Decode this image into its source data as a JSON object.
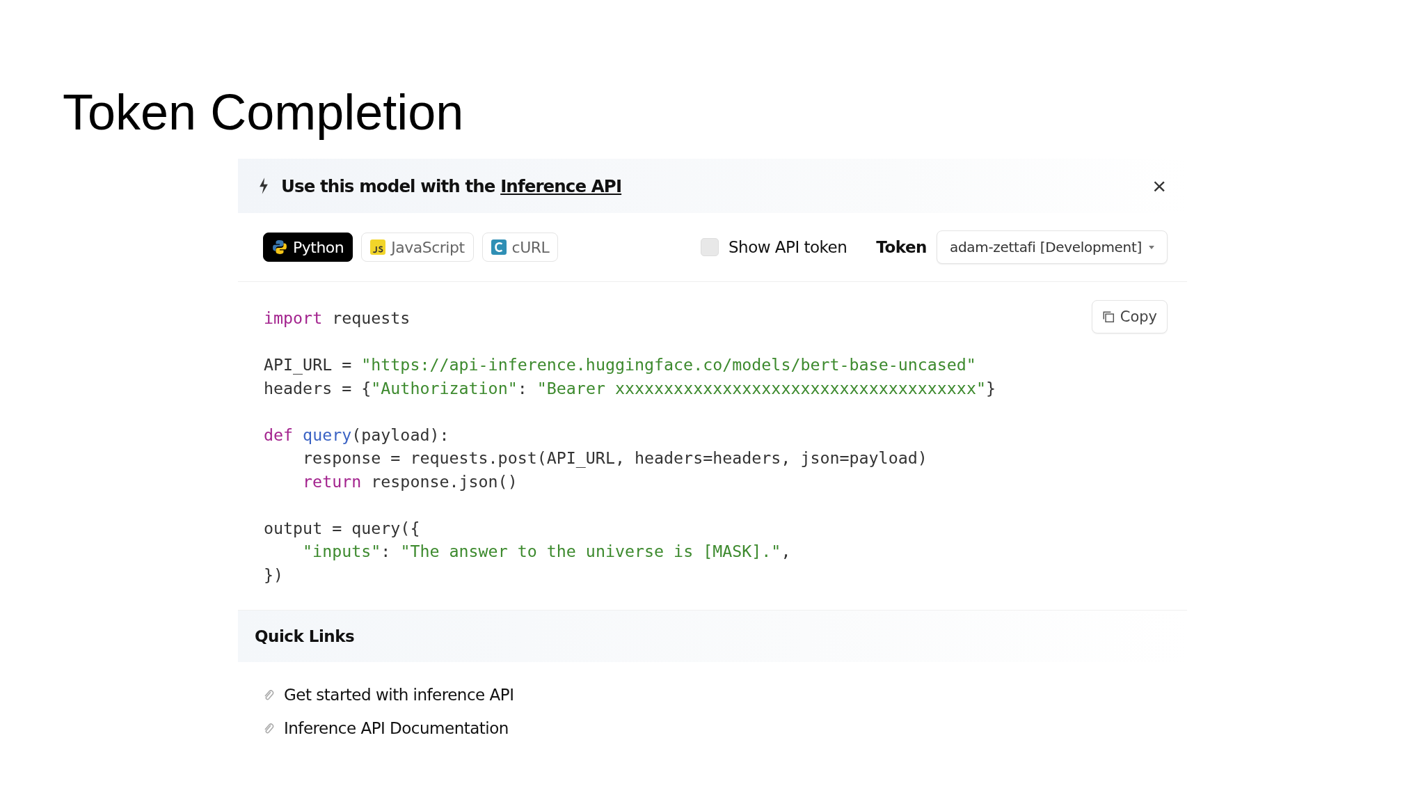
{
  "slide_title": "Token Completion",
  "panel": {
    "header": {
      "prefix": "Use this model with the ",
      "link": "Inference API",
      "close": "×"
    },
    "language_tabs": [
      {
        "label": "Python",
        "kind": "python",
        "selected": true
      },
      {
        "label": "JavaScript",
        "kind": "js",
        "selected": false
      },
      {
        "label": "cURL",
        "kind": "curl",
        "selected": false
      }
    ],
    "show_token": {
      "label": "Show API token",
      "checked": false
    },
    "token": {
      "label": "Token",
      "value": "adam-zettafi [Development]"
    },
    "copy_button": "Copy",
    "code_blocks": [
      [
        {
          "tokens": [
            {
              "kind": "keyword",
              "text": "import"
            },
            {
              "kind": "plain",
              "text": " requests"
            }
          ]
        }
      ],
      [
        {
          "tokens": [
            {
              "kind": "plain",
              "text": "API_URL = "
            },
            {
              "kind": "string",
              "text": "\"https://api-inference.huggingface.co/models/bert-base-uncased\""
            }
          ]
        },
        {
          "tokens": [
            {
              "kind": "plain",
              "text": "headers = {"
            },
            {
              "kind": "string",
              "text": "\"Authorization\""
            },
            {
              "kind": "plain",
              "text": ": "
            },
            {
              "kind": "string",
              "text": "\"Bearer xxxxxxxxxxxxxxxxxxxxxxxxxxxxxxxxxxxxx\""
            },
            {
              "kind": "plain",
              "text": "}"
            }
          ]
        }
      ],
      [
        {
          "tokens": [
            {
              "kind": "keyword",
              "text": "def"
            },
            {
              "kind": "function",
              "text": " query"
            },
            {
              "kind": "plain",
              "text": "(payload):"
            }
          ]
        },
        {
          "indent": true,
          "tokens": [
            {
              "kind": "plain",
              "text": "response = requests.post(API_URL, headers=headers, json=payload)"
            }
          ]
        },
        {
          "indent": true,
          "tokens": [
            {
              "kind": "keyword",
              "text": "return"
            },
            {
              "kind": "plain",
              "text": " response.json()"
            }
          ]
        }
      ],
      [
        {
          "tokens": [
            {
              "kind": "plain",
              "text": "output = query({"
            }
          ]
        },
        {
          "indent": true,
          "tokens": [
            {
              "kind": "string",
              "text": "\"inputs\""
            },
            {
              "kind": "plain",
              "text": ": "
            },
            {
              "kind": "string",
              "text": "\"The answer to the universe is [MASK].\""
            },
            {
              "kind": "plain",
              "text": ","
            }
          ]
        },
        {
          "tokens": [
            {
              "kind": "plain",
              "text": "})"
            }
          ]
        }
      ]
    ],
    "quick_links": {
      "title": "Quick Links",
      "links": [
        "Get started with inference API",
        "Inference API Documentation"
      ]
    }
  }
}
